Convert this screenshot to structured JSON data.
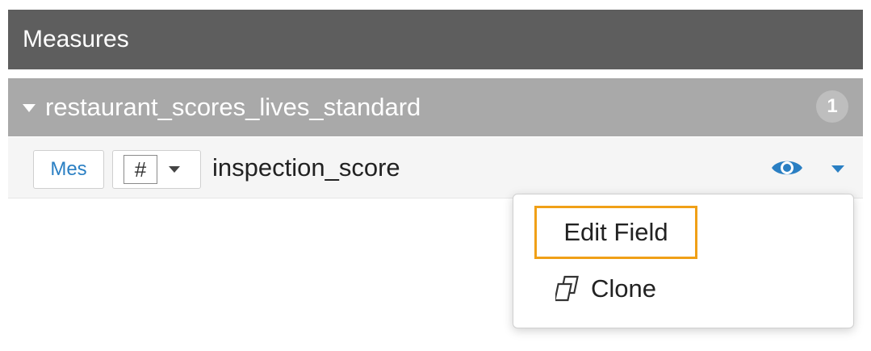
{
  "header": {
    "title": "Measures"
  },
  "group": {
    "name": "restaurant_scores_lives_standard",
    "count": "1"
  },
  "field": {
    "role_label": "Mes",
    "type_symbol": "#",
    "name": "inspection_score",
    "icons": {
      "visibility": "eye-icon",
      "menu": "chevron-down-icon"
    }
  },
  "context_menu": {
    "items": [
      {
        "label": "Edit Field",
        "highlighted": true
      },
      {
        "label": "Clone",
        "icon": "clone-icon"
      }
    ]
  },
  "colors": {
    "header_bg": "#5e5e5e",
    "group_bg": "#a9a9a9",
    "accent_blue": "#2a7fc3",
    "highlight_orange": "#f0a017"
  }
}
